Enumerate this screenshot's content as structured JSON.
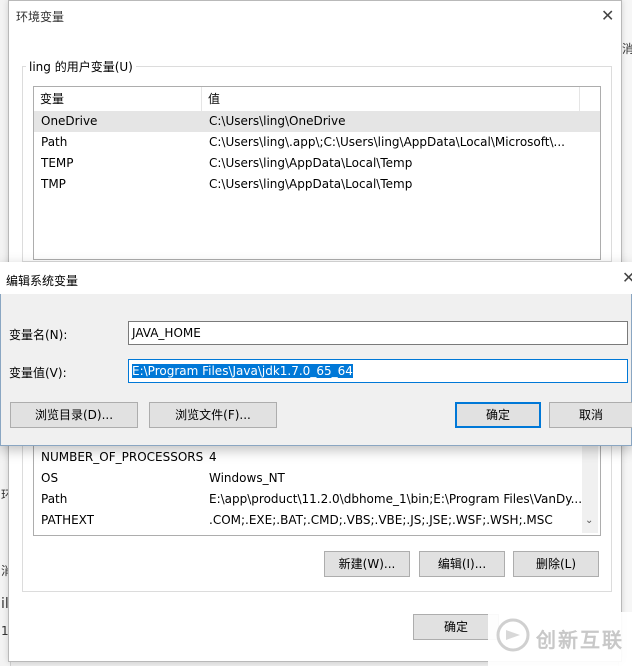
{
  "background": {
    "right_fragment": "消",
    "left_fragments": [
      "环",
      "消",
      "il",
      "1E"
    ]
  },
  "env_window": {
    "title": "环境变量",
    "user_group_title": "ling 的用户变量(U)",
    "columns": [
      "变量",
      "值"
    ],
    "user_vars": [
      {
        "name": "OneDrive",
        "value": "C:\\Users\\ling\\OneDrive"
      },
      {
        "name": "Path",
        "value": "C:\\Users\\ling\\.app\\;C:\\Users\\ling\\AppData\\Local\\Microsoft\\..."
      },
      {
        "name": "TEMP",
        "value": "C:\\Users\\ling\\AppData\\Local\\Temp"
      },
      {
        "name": "TMP",
        "value": "C:\\Users\\ling\\AppData\\Local\\Temp"
      }
    ],
    "system_vars": [
      {
        "name": "NUMBER_OF_PROCESSORS",
        "value": "4"
      },
      {
        "name": "OS",
        "value": "Windows_NT"
      },
      {
        "name": "Path",
        "value": "E:\\app\\product\\11.2.0\\dbhome_1\\bin;E:\\Program Files\\VanDy..."
      },
      {
        "name": "PATHEXT",
        "value": ".COM;.EXE;.BAT;.CMD;.VBS;.VBE;.JS;.JSE;.WSF;.WSH;.MSC"
      }
    ],
    "new_button": "新建(W)...",
    "edit_button": "编辑(I)...",
    "delete_button": "删除(L)",
    "ok_button": "确定"
  },
  "edit_dialog": {
    "title": "编辑系统变量",
    "name_label": "变量名(N):",
    "name_value": "JAVA_HOME",
    "value_label": "变量值(V):",
    "value_value": "E:\\Program Files\\Java\\jdk1.7.0_65_64",
    "browse_dir_button": "浏览目录(D)...",
    "browse_file_button": "浏览文件(F)...",
    "ok_button": "确定",
    "cancel_button": "取消"
  },
  "watermark": {
    "text": "创新互联"
  },
  "icons": {
    "close": "close-icon",
    "scroll_down": "chevron-down-icon",
    "watermark_logo": "logo-icon"
  },
  "colors": {
    "accent": "#0078d7",
    "selection_row": "#e5e5e5"
  }
}
